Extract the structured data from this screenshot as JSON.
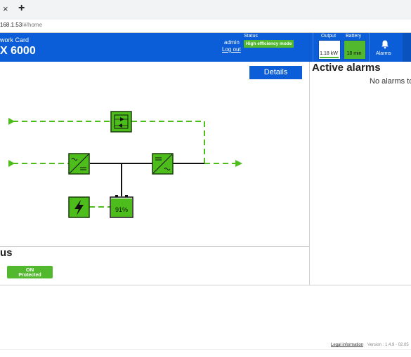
{
  "browser": {
    "tab_close": "×",
    "new_tab": "+",
    "url_host": "168.1.53",
    "url_path": "/#/home"
  },
  "header": {
    "brand_line1": "work Card",
    "brand_line2": "X 6000",
    "user": "admin",
    "logout": "Log out",
    "status_label": "Status",
    "status_value": "High efficiency mode",
    "output_label": "Output",
    "output_value": "1.18 kW",
    "battery_label": "Battery",
    "battery_value": "18 min",
    "alarms_label": "Alarms"
  },
  "main": {
    "details_button": "Details",
    "battery_percent": "91%",
    "status_title": "us",
    "status_on": "ON",
    "status_protected": "Protected"
  },
  "alarms": {
    "title": "Active alarms",
    "empty_text": "No alarms to"
  },
  "footer": {
    "legal": "Legal information",
    "version": "Version : 1.4.9 - 02.05"
  },
  "colors": {
    "header_blue": "#0b5ed7",
    "accent_green": "#52b82e",
    "diagram_green": "#4dbd1c"
  }
}
